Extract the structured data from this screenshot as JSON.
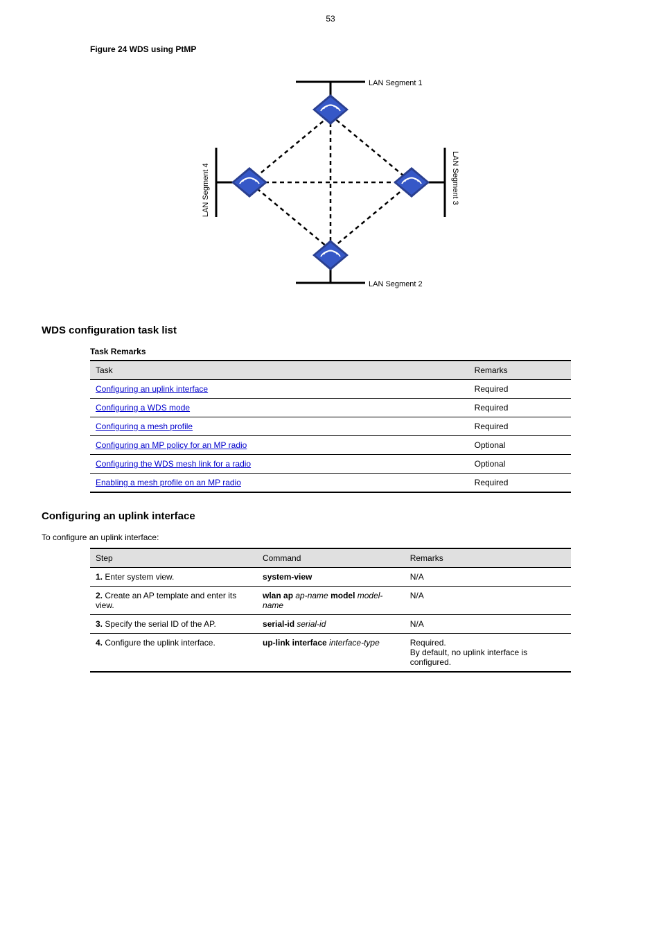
{
  "page_number": "53",
  "figure_caption": "Figure 24 WDS using PtMP",
  "diagram": {
    "lan1": "LAN Segment 1",
    "lan2": "LAN Segment 2",
    "lan3": "LAN Segment 3",
    "lan4": "LAN Segment 4"
  },
  "wds_heading": "WDS configuration task list",
  "table1_caption": "Task Remarks",
  "table1": [
    {
      "task": "Configuring an uplink interface",
      "remarks": "Required"
    },
    {
      "task": "Configuring a WDS mode",
      "remarks": "Required"
    },
    {
      "task": "Configuring a mesh profile",
      "remarks": "Required"
    },
    {
      "task": "Configuring an MP policy for an MP radio",
      "remarks": "Optional"
    },
    {
      "task": "Configuring the WDS mesh link for a radio",
      "remarks": "Optional"
    },
    {
      "task": "Enabling a mesh profile on an MP radio",
      "remarks": "Required"
    }
  ],
  "uplink_heading": "Configuring an uplink interface",
  "uplink_para": "To configure an uplink interface:",
  "table2": [
    {
      "step": "Step",
      "command": "Command",
      "remarks": "Remarks"
    }
  ],
  "table2_rows": [
    {
      "step": "1.",
      "cmd_label": "Enter system view.",
      "command": "system-view",
      "remarks": "N/A"
    },
    {
      "step": "2.",
      "cmd_label": "Create an AP template and enter its view.",
      "command_pre": "wlan ap ",
      "command_arg1": "ap-name",
      "command_mid": " model ",
      "command_arg2": "model-name",
      "remarks": "N/A"
    },
    {
      "step": "3.",
      "cmd_label": "Specify the serial ID of the AP.",
      "command_pre": "serial-id ",
      "command_arg1": "serial-id",
      "remarks": "N/A"
    },
    {
      "step": "4.",
      "cmd_label": "Configure the uplink interface.",
      "command_pre": "up-link interface ",
      "command_arg1": "interface-type",
      "remarks_line1": "Required.",
      "remarks_line2": "By default, no uplink interface is configured."
    }
  ]
}
